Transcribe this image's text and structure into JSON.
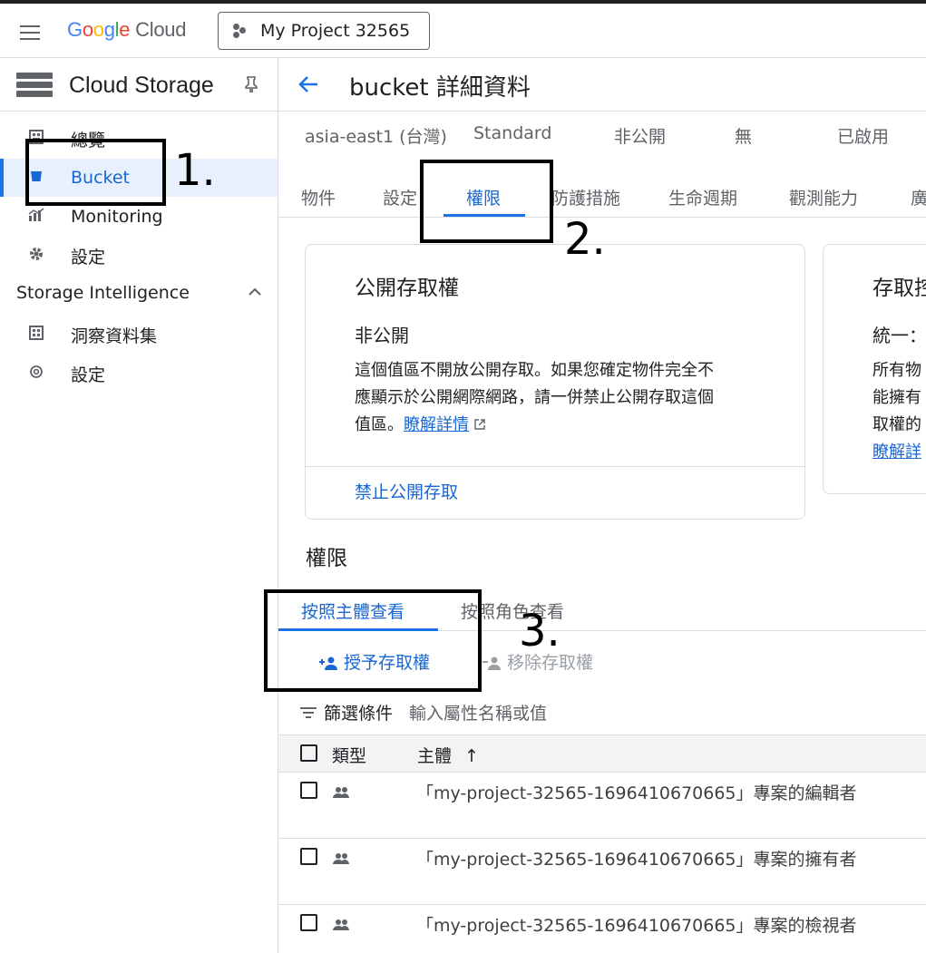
{
  "header": {
    "logo_letters": [
      "G",
      "o",
      "o",
      "g",
      "l",
      "e"
    ],
    "logo_suffix": "Cloud",
    "project": "My Project 32565"
  },
  "sidebar": {
    "title": "Cloud Storage",
    "items": [
      {
        "label": "總覽",
        "icon": "overview-icon"
      },
      {
        "label": "Bucket",
        "icon": "bucket-icon",
        "active": true
      },
      {
        "label": "Monitoring",
        "icon": "monitoring-icon"
      },
      {
        "label": "設定",
        "icon": "gear-icon"
      }
    ],
    "section": "Storage Intelligence",
    "section_items": [
      {
        "label": "洞察資料集",
        "icon": "dataset-icon"
      },
      {
        "label": "設定",
        "icon": "gear-outline-icon"
      }
    ]
  },
  "main": {
    "title": "bucket 詳細資料",
    "meta": [
      "asia-east1 (台灣)",
      "Standard",
      "非公開",
      "無",
      "已啟用"
    ],
    "tabs": [
      "物件",
      "設定",
      "權限",
      "防護措施",
      "生命週期",
      "觀測能力",
      "廣"
    ],
    "active_tab": "權限",
    "public_access_card": {
      "title": "公開存取權",
      "status": "非公開",
      "body_line1": "這個值區不開放公開存取。如果您確定物件完全不",
      "body_line2": "應顯示於公開網際網路，請一併禁止公開存取這個",
      "body_line3": "值區。",
      "learn_more": "瞭解詳情",
      "action": "禁止公開存取"
    },
    "access_control_card": {
      "title": "存取控",
      "status": "統一：",
      "body_line1": "所有物",
      "body_line2": "能擁有",
      "body_line3": "取權的",
      "learn_more": "瞭解詳"
    },
    "permissions": {
      "title": "權限",
      "subtabs": [
        "按照主體查看",
        "按照角色查看"
      ],
      "grant_button": "授予存取權",
      "remove_button": "移除存取權",
      "filter_label": "篩選條件",
      "filter_placeholder": "輸入屬性名稱或值",
      "columns": [
        "類型",
        "主體"
      ],
      "sort_arrow": "↑",
      "rows": [
        "「my-project-32565-1696410670665」專案的編輯者",
        "「my-project-32565-1696410670665」專案的擁有者",
        "「my-project-32565-1696410670665」專案的檢視者"
      ]
    }
  },
  "annotations": [
    "1.",
    "2.",
    "3."
  ]
}
